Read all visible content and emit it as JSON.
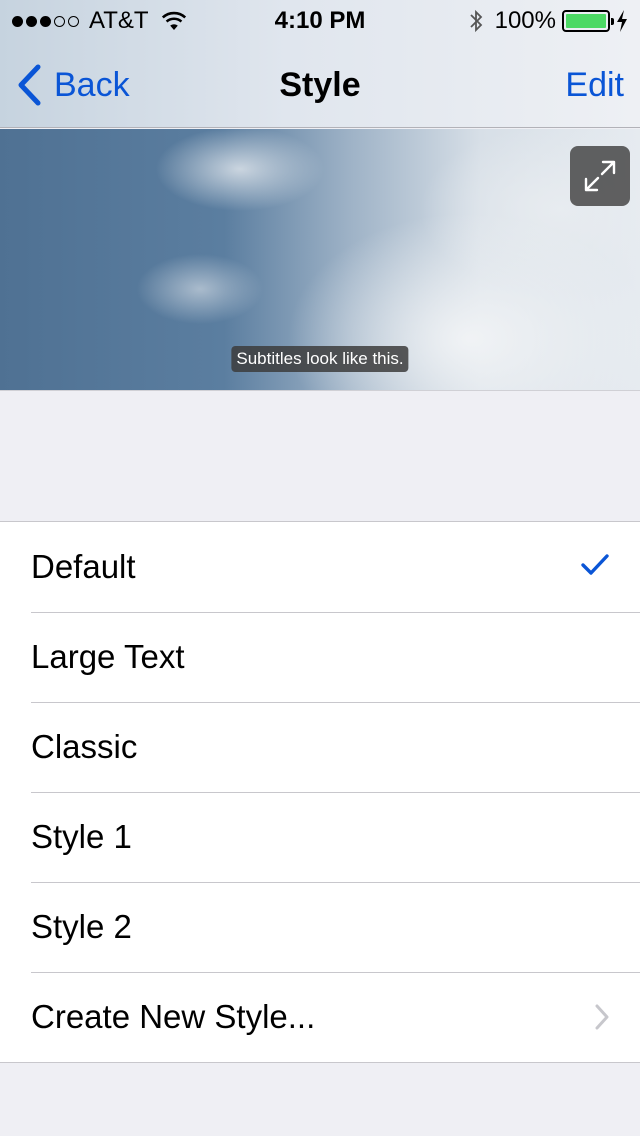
{
  "status_bar": {
    "signal_dots_filled": 3,
    "signal_dots_total": 5,
    "carrier": "AT&T",
    "time": "4:10 PM",
    "battery_percent": "100%",
    "battery_level": 1.0,
    "battery_color": "#4cd964",
    "icons": [
      "wifi-icon",
      "bluetooth-icon",
      "battery-icon",
      "charging-icon"
    ]
  },
  "nav": {
    "back_label": "Back",
    "title": "Style",
    "edit_label": "Edit",
    "accent_color": "#0a55d6"
  },
  "preview": {
    "subtitle_text": "Subtitles look like this.",
    "expand_icon": "expand-icon"
  },
  "styles": {
    "items": [
      {
        "label": "Default",
        "selected": true
      },
      {
        "label": "Large Text",
        "selected": false
      },
      {
        "label": "Classic",
        "selected": false
      },
      {
        "label": "Style 1",
        "selected": false
      },
      {
        "label": "Style 2",
        "selected": false
      }
    ],
    "create_label": "Create New Style..."
  }
}
